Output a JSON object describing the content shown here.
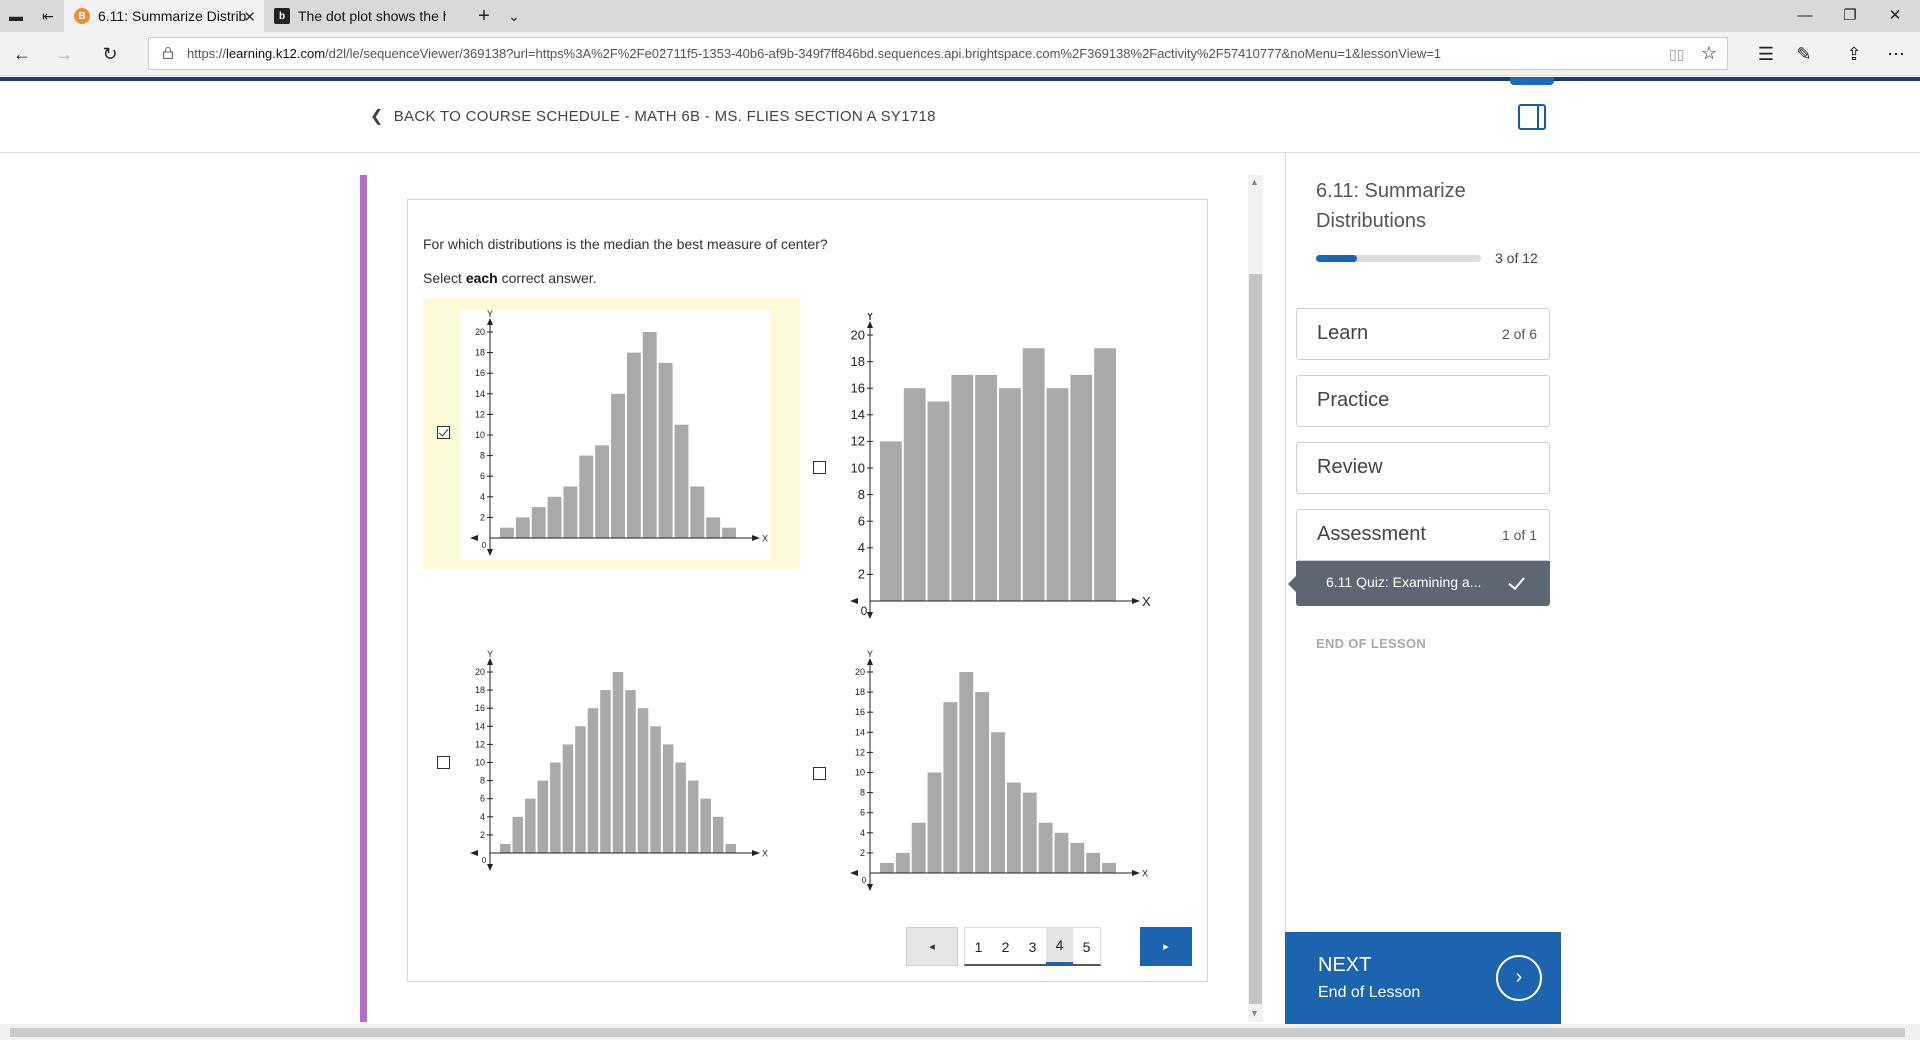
{
  "browser": {
    "tabs": [
      {
        "title": "6.11: Summarize Distrib",
        "active": true
      },
      {
        "title": "The dot plot shows the heig",
        "active": false
      }
    ],
    "url_prefix": "https://",
    "url_host": "learning.k12.com",
    "url_path": "/d2l/le/sequenceViewer/369138?url=https%3A%2F%2Fe02711f5-1353-40b6-af9b-349f7ff846bd.sequences.api.brightspace.com%2F369138%2Factivity%2F57410777&noMenu=1&lessonView=1"
  },
  "header": {
    "back_label": "BACK TO COURSE SCHEDULE - MATH 6B - MS. FLIES SECTION A SY1718"
  },
  "question": {
    "prompt": "For which distributions is the median the best measure of center?",
    "instruction_prefix": "Select ",
    "instruction_bold": "each",
    "instruction_suffix": " correct answer."
  },
  "answer_checked": [
    true,
    false,
    false,
    false
  ],
  "chart_data": [
    {
      "type": "bar",
      "xlabel": "X",
      "ylabel": "Y",
      "origin_label": "0",
      "ylim": [
        0,
        20
      ],
      "yticks": [
        2,
        4,
        6,
        8,
        10,
        12,
        14,
        16,
        18,
        20
      ],
      "values": [
        1,
        2,
        3,
        4,
        5,
        8,
        9,
        14,
        18,
        20,
        17,
        11,
        5,
        2,
        1
      ]
    },
    {
      "type": "bar",
      "xlabel": "X",
      "ylabel": "Y",
      "origin_label": "0",
      "ylim": [
        0,
        20
      ],
      "yticks": [
        2,
        4,
        6,
        8,
        10,
        12,
        14,
        16,
        18,
        20
      ],
      "values": [
        12,
        16,
        15,
        17,
        17,
        16,
        19,
        16,
        17,
        19
      ]
    },
    {
      "type": "bar",
      "xlabel": "X",
      "ylabel": "Y",
      "origin_label": "0",
      "ylim": [
        0,
        20
      ],
      "yticks": [
        2,
        4,
        6,
        8,
        10,
        12,
        14,
        16,
        18,
        20
      ],
      "values": [
        1,
        4,
        6,
        8,
        10,
        12,
        14,
        16,
        18,
        20,
        18,
        16,
        14,
        12,
        10,
        8,
        6,
        4,
        1
      ]
    },
    {
      "type": "bar",
      "xlabel": "X",
      "ylabel": "Y",
      "origin_label": "0",
      "ylim": [
        0,
        20
      ],
      "yticks": [
        2,
        4,
        6,
        8,
        10,
        12,
        14,
        16,
        18,
        20
      ],
      "values": [
        1,
        2,
        5,
        10,
        17,
        20,
        18,
        14,
        9,
        8,
        5,
        4,
        3,
        2,
        1
      ]
    }
  ],
  "pagination": {
    "prev": "◂",
    "next": "▸",
    "pages": [
      "1",
      "2",
      "3",
      "4",
      "5"
    ],
    "current_index": 3
  },
  "sidebar": {
    "title": "6.11: Summarize Distributions",
    "progress_text": "3 of 12",
    "progress_fraction": 0.25,
    "items": [
      {
        "label": "Learn",
        "count": "2 of 6"
      },
      {
        "label": "Practice",
        "count": ""
      },
      {
        "label": "Review",
        "count": ""
      },
      {
        "label": "Assessment",
        "count": "1 of 1"
      }
    ],
    "active_subitem": "6.11 Quiz: Examining a...",
    "end_label": "END OF LESSON"
  },
  "next_button": {
    "title": "NEXT",
    "subtitle": "End of Lesson"
  },
  "colors": {
    "accent": "#b46ec8",
    "primary": "#1d63b0",
    "bar": "#a9a9a9",
    "selected_bg": "#fdfbd7"
  }
}
